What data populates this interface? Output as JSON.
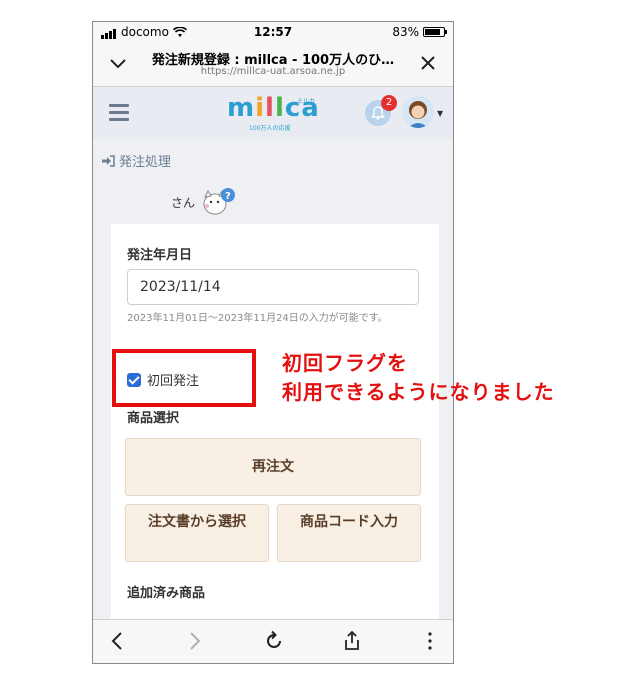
{
  "status_bar": {
    "carrier": "docomo",
    "time": "12:57",
    "battery": "83%"
  },
  "browser": {
    "title": "発注新規登録 : millca - 100万人のひ…",
    "url": "https://millca-uat.arsoa.ne.jp"
  },
  "app": {
    "logo": {
      "text": "millca",
      "tagline": "100万人の応援",
      "kana": "ミルカ"
    },
    "notification_count": "2"
  },
  "breadcrumb": {
    "label": "発注処理"
  },
  "user": {
    "suffix": "さん"
  },
  "form": {
    "date_label": "発注年月日",
    "date_value": "2023/11/14",
    "date_hint": "2023年11月01日～2023年11月24日の入力が可能です。",
    "first_order_label": "初回発注",
    "first_order_checked": true,
    "product_select_label": "商品選択",
    "reorder_button": "再注文",
    "from_order_form_button": "注文書から選択",
    "product_code_button": "商品コード入力",
    "added_products_label": "追加済み商品"
  },
  "annotation": {
    "line1": "初回フラグを",
    "line2": "利用できるようになりました",
    "color": "#e3100f"
  }
}
